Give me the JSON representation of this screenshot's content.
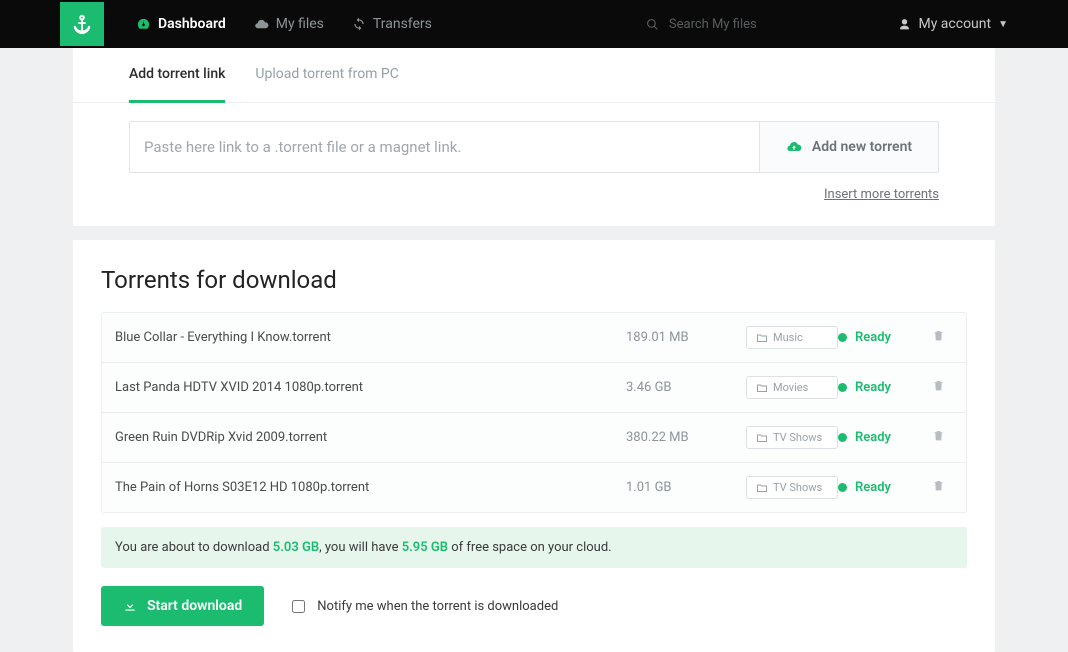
{
  "nav": {
    "dashboard": "Dashboard",
    "myfiles": "My files",
    "transfers": "Transfers",
    "search_placeholder": "Search My files",
    "account": "My account"
  },
  "tabs": {
    "add_link": "Add torrent link",
    "upload_pc": "Upload torrent from PC"
  },
  "input": {
    "placeholder": "Paste here link to a .torrent file or a magnet link.",
    "add_btn": "Add new torrent",
    "insert_more": "Insert more torrents"
  },
  "section_title": "Torrents for download",
  "torrents": [
    {
      "name": "Blue Collar - Everything I Know.torrent",
      "size": "189.01 MB",
      "category": "Music",
      "status": "Ready"
    },
    {
      "name": "Last Panda HDTV XVID 2014 1080p.torrent",
      "size": "3.46 GB",
      "category": "Movies",
      "status": "Ready"
    },
    {
      "name": "Green Ruin DVDRip Xvid 2009.torrent",
      "size": "380.22 MB",
      "category": "TV Shows",
      "status": "Ready"
    },
    {
      "name": "The Pain of Horns S03E12 HD 1080p.torrent",
      "size": "1.01 GB",
      "category": "TV Shows",
      "status": "Ready"
    }
  ],
  "summary": {
    "prefix": "You are about to download ",
    "total": "5.03 GB",
    "middle": ", you will have ",
    "free": "5.95 GB",
    "suffix": " of free space on your cloud."
  },
  "actions": {
    "start": "Start download",
    "notify": "Notify me when the torrent is downloaded"
  }
}
